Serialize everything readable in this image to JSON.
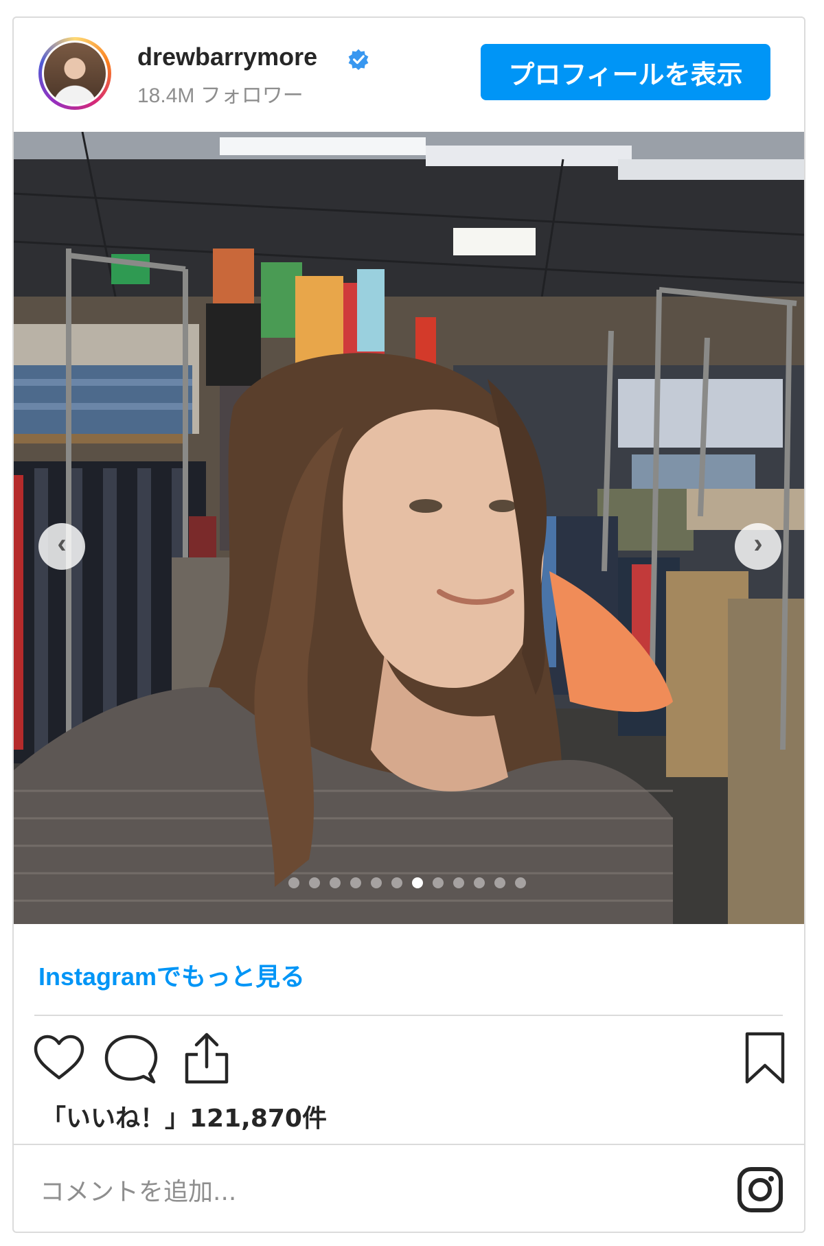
{
  "header": {
    "username": "drewbarrymore",
    "verified_icon": "verified-badge-icon",
    "followers": "18.4M フォロワー",
    "profile_button": "プロフィールを表示"
  },
  "post": {
    "image_description_icon": "photo",
    "carousel": {
      "total": 12,
      "active_index": 6
    },
    "prev_icon": "chevron-left-icon",
    "next_icon": "chevron-right-icon"
  },
  "more_link": "Instagramでもっと見る",
  "actions": {
    "like_icon": "heart-icon",
    "comment_icon": "comment-icon",
    "share_icon": "share-icon",
    "save_icon": "bookmark-icon"
  },
  "likes": "「いいね！」121,870件",
  "comment": {
    "placeholder": "コメントを追加...",
    "logo_icon": "instagram-icon"
  },
  "colors": {
    "accent": "#0095f6",
    "border": "#dbdbdb",
    "muted": "#8e8e8e"
  }
}
